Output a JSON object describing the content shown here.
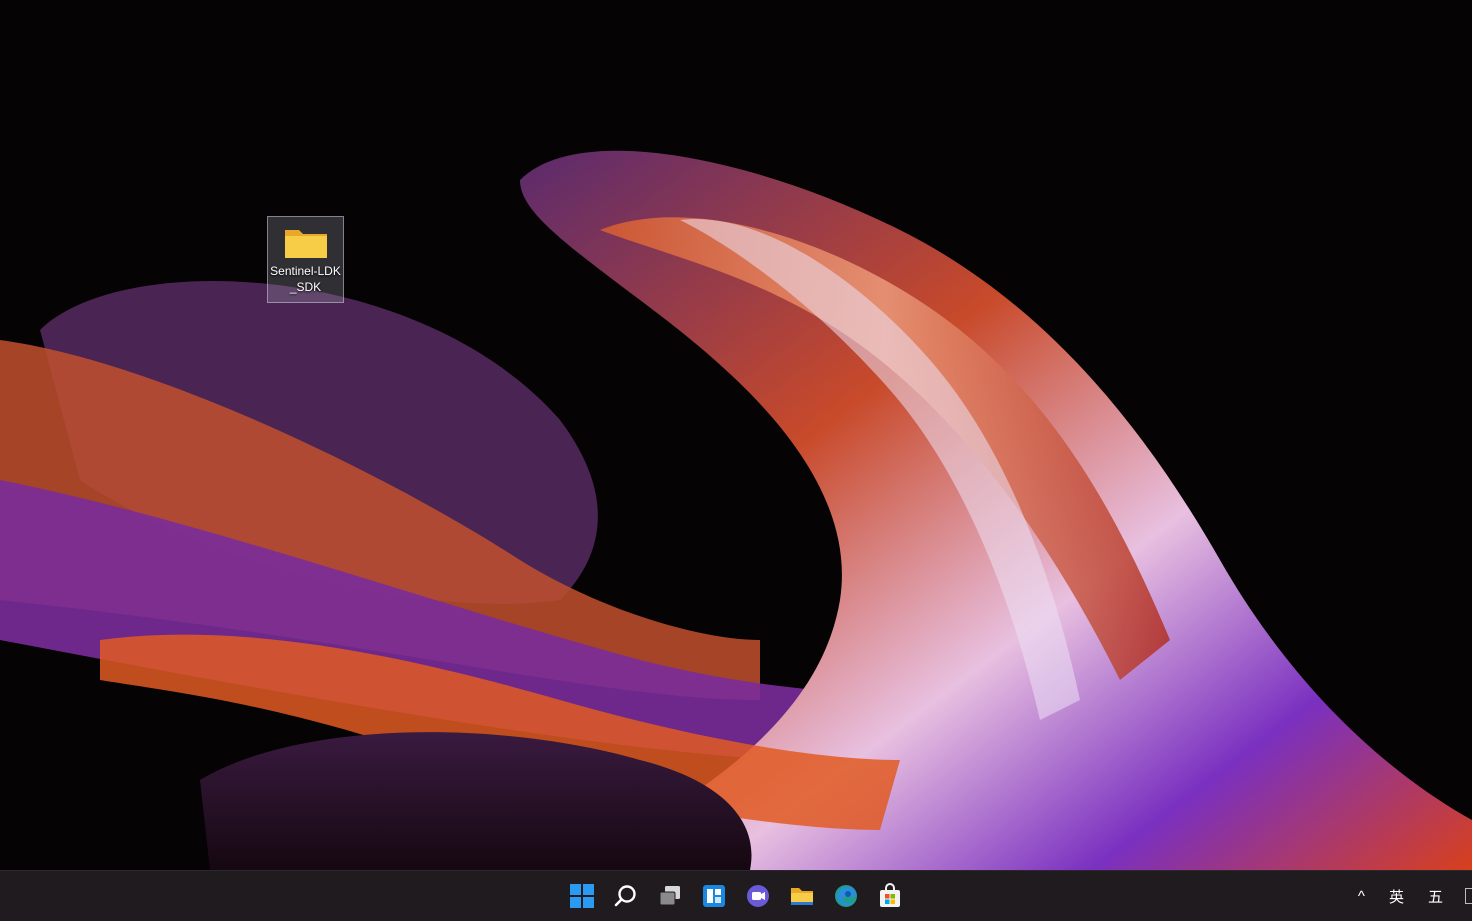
{
  "desktop": {
    "icons": [
      {
        "label": "Sentinel-LDK_SDK",
        "icon": "folder-icon"
      }
    ]
  },
  "taskbar": {
    "apps": [
      {
        "name": "start-button",
        "icon": "windows-logo-icon"
      },
      {
        "name": "search-button",
        "icon": "search-icon"
      },
      {
        "name": "task-view-button",
        "icon": "task-view-icon"
      },
      {
        "name": "widgets-button",
        "icon": "widgets-icon"
      },
      {
        "name": "teams-chat-button",
        "icon": "teams-chat-icon"
      },
      {
        "name": "file-explorer-button",
        "icon": "file-explorer-icon"
      },
      {
        "name": "edge-button",
        "icon": "edge-icon"
      },
      {
        "name": "store-button",
        "icon": "store-icon"
      }
    ],
    "tray": {
      "overflow_label": "^",
      "input_language_label": "英",
      "ime_mode_label": "五"
    }
  },
  "colors": {
    "taskbar_bg": "#1f1b1f",
    "folder": "#f5c842",
    "accent_windows": "#2b9af3"
  }
}
